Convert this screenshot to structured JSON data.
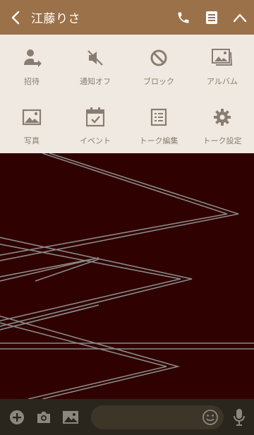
{
  "header": {
    "title": "江藤りさ",
    "back_icon": "chevron-left-icon",
    "call_icon": "phone-icon",
    "notes_icon": "notes-icon",
    "collapse_icon": "chevron-up-icon"
  },
  "menu": {
    "items": [
      {
        "label": "招待",
        "icon": "invite-icon"
      },
      {
        "label": "通知オフ",
        "icon": "mute-icon"
      },
      {
        "label": "ブロック",
        "icon": "block-icon"
      },
      {
        "label": "アルバム",
        "icon": "album-icon"
      },
      {
        "label": "写真",
        "icon": "photo-icon"
      },
      {
        "label": "イベント",
        "icon": "calendar-icon"
      },
      {
        "label": "トーク編集",
        "icon": "edit-list-icon"
      },
      {
        "label": "トーク設定",
        "icon": "gear-icon"
      }
    ]
  },
  "colors": {
    "header_bg": "#9a7148",
    "menu_bg": "#efe9e2",
    "menu_icon": "#8a7d70",
    "chat_bg": "#2f0100",
    "pattern_line": "#8a8a8a",
    "footer_bg": "#2b261d"
  },
  "footer": {
    "add_icon": "plus-circle-icon",
    "camera_icon": "camera-icon",
    "image_icon": "image-icon",
    "emoji_icon": "emoji-icon",
    "mic_icon": "mic-icon"
  }
}
